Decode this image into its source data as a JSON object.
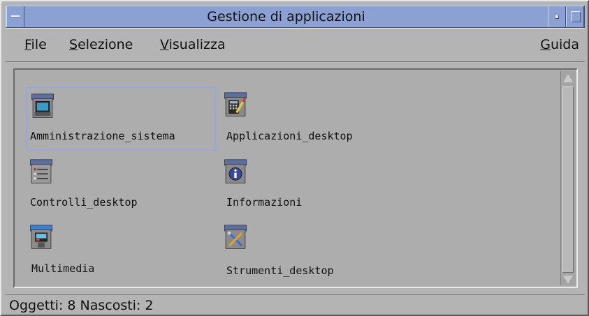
{
  "window": {
    "title": "Gestione di applicazioni"
  },
  "menubar": {
    "file": {
      "label": "File",
      "mnemonic": "F",
      "rest": "ile"
    },
    "selection": {
      "label": "Selezione",
      "mnemonic": "S",
      "rest": "elezione"
    },
    "view": {
      "label": "Visualizza",
      "mnemonic": "V",
      "rest": "isualizza"
    },
    "help": {
      "label": "Guida",
      "mnemonic": "G",
      "rest": "uida"
    }
  },
  "items": [
    {
      "label": "Amministrazione_sistema",
      "icon": "computer-monitor-icon",
      "selected": true
    },
    {
      "label": "Applicazioni_desktop",
      "icon": "calculator-pencil-icon",
      "selected": false
    },
    {
      "label": "Controlli_desktop",
      "icon": "control-panel-icon",
      "selected": false
    },
    {
      "label": "Informazioni",
      "icon": "info-icon",
      "selected": false
    },
    {
      "label": "Multimedia",
      "icon": "multimedia-icon",
      "selected": false
    },
    {
      "label": "Strumenti_desktop",
      "icon": "tools-icon",
      "selected": false
    }
  ],
  "status": {
    "text": "Oggetti: 8 Nascosti: 2"
  },
  "colors": {
    "titlebar": "#8ba1d3",
    "window_bg": "#b4b4b4",
    "selection": "#93a9dc"
  }
}
